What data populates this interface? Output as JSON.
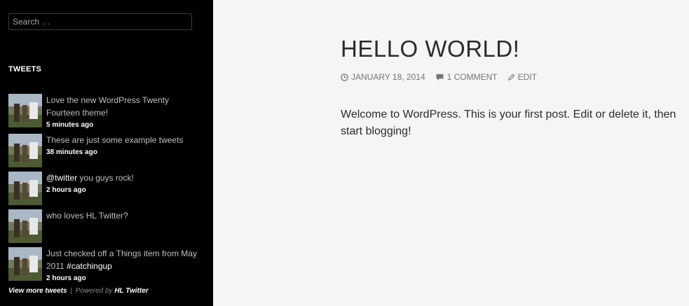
{
  "search": {
    "placeholder": "Search …"
  },
  "tweets_widget": {
    "title": "TWEETS",
    "items": [
      {
        "parts": [
          "Love the new WordPress Twenty Fourteen theme!"
        ],
        "time": "5 minutes ago"
      },
      {
        "parts": [
          "These are just some example tweets"
        ],
        "time": "38 minutes ago"
      },
      {
        "mention": "@twitter",
        "text": " you guys rock!",
        "time": "2 hours ago"
      },
      {
        "text": "who loves HL Twitter?"
      },
      {
        "text": "Just checked off a Things item from May 2011 ",
        "hashtag": "#catchingup",
        "time": "2 hours ago"
      }
    ],
    "footer": {
      "more": "View more tweets",
      "separator": "|",
      "powered": "Powered by",
      "hl": "HL Twitter"
    }
  },
  "post": {
    "title": "HELLO WORLD!",
    "date": "JANUARY 18, 2014",
    "comments": "1 COMMENT",
    "edit": "EDIT",
    "body": "Welcome to WordPress. This is your first post. Edit or delete it, then start blogging!"
  },
  "icons": {
    "clock": "clock-icon",
    "comment": "comment-bubble-icon",
    "edit": "pencil-icon"
  }
}
